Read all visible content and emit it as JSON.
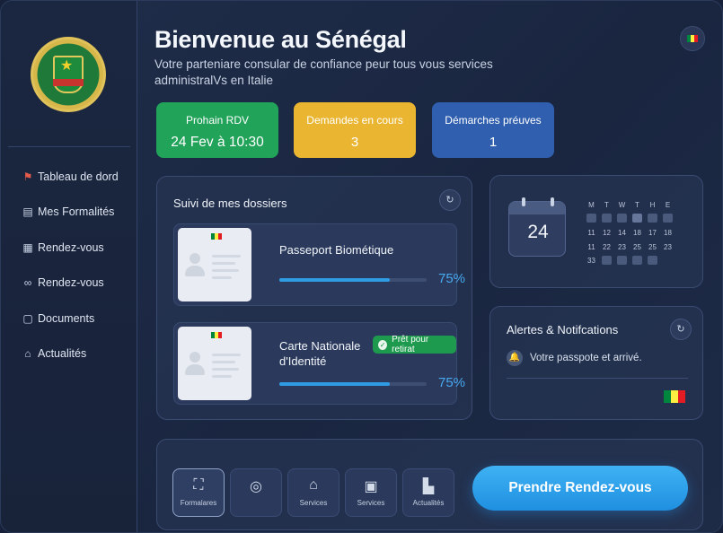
{
  "header": {
    "title": "Bienvenue au Sénégal",
    "subtitle": "Votre parteniare consular de confiance peur tous vous services administralVs en Italie"
  },
  "sidebar": {
    "items": [
      {
        "label": "Tableau de dord",
        "icon": "flag-icon"
      },
      {
        "label": "Mes Formalités",
        "icon": "document-stack-icon"
      },
      {
        "label": "Rendez-vous",
        "icon": "calendar-icon"
      },
      {
        "label": "Rendez-vous",
        "icon": "link-icon"
      },
      {
        "label": "Documents",
        "icon": "document-icon"
      },
      {
        "label": "Actualités",
        "icon": "home-icon"
      }
    ]
  },
  "stats": [
    {
      "label": "Prohain RDV",
      "value": "24 Fev à 10:30",
      "color": "#22a35a"
    },
    {
      "label": "Demandes en cours",
      "value": "3",
      "color": "#eab632"
    },
    {
      "label": "Démarches préuves",
      "value": "1",
      "color": "#2f5fae"
    }
  ],
  "dossiers": {
    "title": "Suivi de mes dossiers",
    "items": [
      {
        "name": "Passeport Biométique",
        "progress_label": "75%",
        "progress": 0.75,
        "badge": ""
      },
      {
        "name": "Carte Nationale d'Identité",
        "name_line1": "Carte Nationale",
        "name_line2": "d'Identité",
        "progress_label": "75%",
        "progress": 0.75,
        "badge": "Prêt pour retirat"
      }
    ]
  },
  "calendar": {
    "day": "24",
    "weekdays": [
      "M",
      "T",
      "W",
      "T",
      "H",
      "E"
    ],
    "row2": [
      "11",
      "12",
      "14",
      "18",
      "17",
      "18"
    ],
    "row3": [
      "11",
      "22",
      "23",
      "25",
      "25",
      "23"
    ],
    "row4": [
      "33"
    ]
  },
  "alerts": {
    "title": "Alertes & Notifcations",
    "message": "Votre passpote et arrivé."
  },
  "quick_actions": [
    {
      "label": "Formalares",
      "icon": "scan-icon"
    },
    {
      "label": "",
      "icon": "globe-icon"
    },
    {
      "label": "Services",
      "icon": "building-icon"
    },
    {
      "label": "Services",
      "icon": "clipboard-icon"
    },
    {
      "label": "Actualités",
      "icon": "news-icon"
    }
  ],
  "cta": {
    "label": "Prendre Rendez-vous"
  },
  "colors": {
    "senegal_green": "#00853f",
    "senegal_yellow": "#fdef42",
    "senegal_red": "#e31b23",
    "accent_blue": "#2f9be3"
  }
}
